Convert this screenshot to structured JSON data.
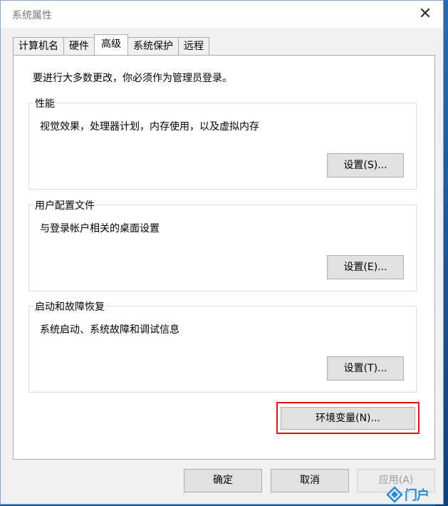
{
  "window": {
    "title": "系统属性"
  },
  "tabs": [
    {
      "label": "计算机名"
    },
    {
      "label": "硬件"
    },
    {
      "label": "高级"
    },
    {
      "label": "系统保护"
    },
    {
      "label": "远程"
    }
  ],
  "panel": {
    "intro": "要进行大多数更改，你必须作为管理员登录。",
    "performance": {
      "title": "性能",
      "description": "视觉效果，处理器计划，内存使用，以及虚拟内存",
      "button": "设置(S)..."
    },
    "user_profiles": {
      "title": "用户配置文件",
      "description": "与登录帐户相关的桌面设置",
      "button": "设置(E)..."
    },
    "startup_recovery": {
      "title": "启动和故障恢复",
      "description": "系统启动、系统故障和调试信息",
      "button": "设置(T)..."
    },
    "env_button": "环境变量(N)..."
  },
  "buttons": {
    "ok": "确定",
    "cancel": "取消",
    "apply": "应用(A)"
  },
  "watermark": {
    "text": "门户"
  },
  "colors": {
    "highlight": "#d9141c",
    "panel_bg": "#ffffff",
    "window_bg": "#f0f0f0"
  }
}
